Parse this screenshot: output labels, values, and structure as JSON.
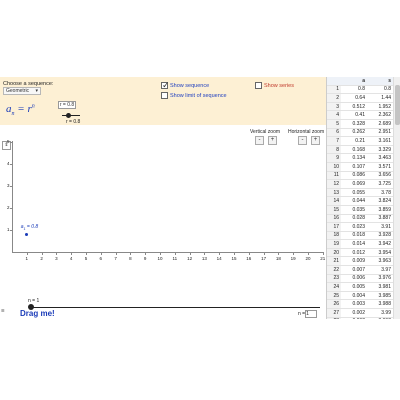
{
  "panel": {
    "choose_label": "Choose a sequence:",
    "sequence_type": "Geometric",
    "formula_lhs": "a",
    "formula_sub": "n",
    "formula_rhs": "r",
    "formula_exp": "n",
    "r_input": "r = 0.8",
    "r_slider_value": 0.8,
    "r_label": "r = 0.8"
  },
  "checkboxes": {
    "show_sequence": {
      "label": "Show sequence",
      "checked": true
    },
    "show_limit": {
      "label": "Show limit of sequence",
      "checked": false
    },
    "show_series": {
      "label": "Show series",
      "checked": false
    }
  },
  "zoom": {
    "vertical_label": "Vertical zoom",
    "horizontal_label": "Horizontal zoom",
    "minus": "-",
    "plus": "+"
  },
  "graph": {
    "x_ticks": [
      "1",
      "2",
      "3",
      "4",
      "5",
      "6",
      "7",
      "8",
      "9",
      "10",
      "11",
      "12",
      "13",
      "14",
      "15",
      "16",
      "17",
      "18",
      "19",
      "20",
      "21"
    ],
    "y_ticks": [
      "1",
      "2",
      "3",
      "4",
      "5"
    ],
    "point_label": "a",
    "point_label_sub": "1",
    "point_label_value": " = 0.8"
  },
  "controls": {
    "n_label": "n = 1",
    "drag_label": "Drag me!",
    "n_box_label": "n = ",
    "n_box_value": "1",
    "n_slider_value": 1
  },
  "table": {
    "headers": [
      "",
      "a",
      "s"
    ],
    "rows": [
      [
        "1",
        "0.8",
        "0.8"
      ],
      [
        "2",
        "0.64",
        "1.44"
      ],
      [
        "3",
        "0.512",
        "1.952"
      ],
      [
        "4",
        "0.41",
        "2.362"
      ],
      [
        "5",
        "0.328",
        "2.689"
      ],
      [
        "6",
        "0.262",
        "2.951"
      ],
      [
        "7",
        "0.21",
        "3.161"
      ],
      [
        "8",
        "0.168",
        "3.329"
      ],
      [
        "9",
        "0.134",
        "3.463"
      ],
      [
        "10",
        "0.107",
        "3.571"
      ],
      [
        "11",
        "0.086",
        "3.656"
      ],
      [
        "12",
        "0.069",
        "3.725"
      ],
      [
        "13",
        "0.055",
        "3.78"
      ],
      [
        "14",
        "0.044",
        "3.824"
      ],
      [
        "15",
        "0.035",
        "3.859"
      ],
      [
        "16",
        "0.028",
        "3.887"
      ],
      [
        "17",
        "0.023",
        "3.91"
      ],
      [
        "18",
        "0.018",
        "3.928"
      ],
      [
        "19",
        "0.014",
        "3.942"
      ],
      [
        "20",
        "0.012",
        "3.954"
      ],
      [
        "21",
        "0.009",
        "3.963"
      ],
      [
        "22",
        "0.007",
        "3.97"
      ],
      [
        "23",
        "0.006",
        "3.976"
      ],
      [
        "24",
        "0.005",
        "3.981"
      ],
      [
        "25",
        "0.004",
        "3.985"
      ],
      [
        "26",
        "0.003",
        "3.988"
      ],
      [
        "27",
        "0.002",
        "3.99"
      ],
      [
        "28",
        "0.002",
        "3.992"
      ],
      [
        "29",
        "0.002",
        "3.994"
      ]
    ]
  },
  "colors": {
    "panel_bg": "#fdf0d4",
    "accent_blue": "#1a3bb8",
    "series_red": "#c0392b"
  }
}
